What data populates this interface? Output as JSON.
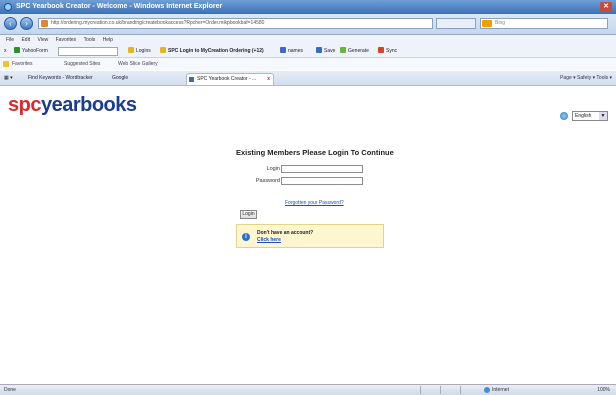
{
  "window": {
    "title": "SPC Yearbook Creator - Welcome - Windows Internet Explorer",
    "url": "http://ordering.mycreation.co.uk/branding/createbookaccess?Rpcher=Order.mikpbookbaf=14580"
  },
  "search": {
    "placeholder": "Bing"
  },
  "menu": {
    "items": [
      "File",
      "Edit",
      "View",
      "Favorites",
      "Tools",
      "Help"
    ]
  },
  "toolbar": {
    "yahoo_label": "YahooForm",
    "search_field": "Search",
    "logins_label": "Logins",
    "spc_login_label": "SPC Login to MyCreation Ordering (+12)",
    "names_label": "names",
    "save_label": "Save",
    "generate_label": "Generate",
    "sync_label": "Sync"
  },
  "favorites": {
    "label": "Favorites",
    "suggested": "Suggested Sites",
    "web_slice": "Web Slice Gallery"
  },
  "tabs": {
    "find_keywords": "Find Keywords - Wordtracker",
    "google": "Google",
    "active": "SPC Yearbook Creator - ...",
    "tools_right": "Page ▾  Safety ▾  Tools ▾"
  },
  "page": {
    "logo_part1": "spc",
    "logo_part2": "yearbooks",
    "language": "English",
    "heading": "Existing Members Please Login To Continue",
    "login_label": "Login",
    "password_label": "Password",
    "forgot_link": "Forgotten your Password?",
    "login_button": "Login",
    "notice_question": "Don't have an account?",
    "notice_link": "Click here"
  },
  "status": {
    "left": "Done",
    "zone": "Internet",
    "zoom": "100%"
  },
  "colors": {
    "logo_red": "#e0272b",
    "logo_blue": "#1a3d8f",
    "link": "#1a4fbf",
    "notice_bg": "#fdf6cf"
  }
}
